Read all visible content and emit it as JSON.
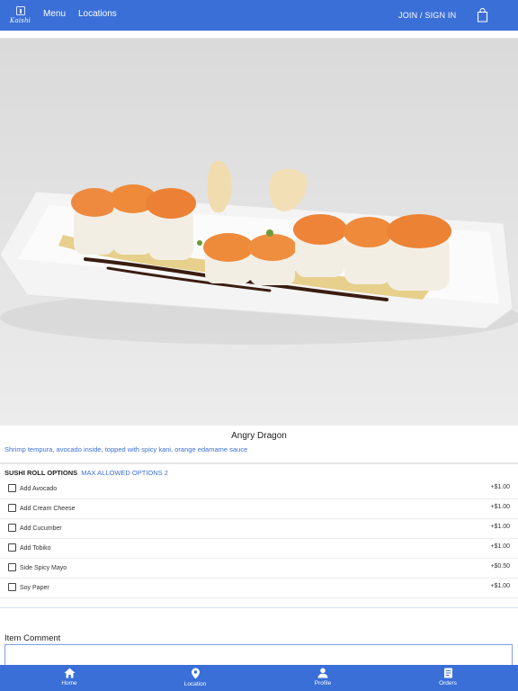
{
  "header": {
    "logo_text": "Kaishi",
    "nav": [
      {
        "label": "Menu"
      },
      {
        "label": "Locations"
      }
    ],
    "signin_label": "JOIN / SIGN IN",
    "cart_icon": "shopping-bag-icon"
  },
  "item": {
    "image_alt": "Angry Dragon sushi roll",
    "title": "Angry Dragon",
    "description": "Shrimp tempura, avocado inside, topped with spicy kani, orange edamame sauce"
  },
  "options": {
    "header_label": "SUSHI ROLL OPTIONS",
    "max_label": "MAX ALLOWED OPTIONS 2",
    "items": [
      {
        "name": "Add Avocado",
        "price": "+$1.00"
      },
      {
        "name": "Add Cream Cheese",
        "price": "+$1.00"
      },
      {
        "name": "Add Cucumber",
        "price": "+$1.00"
      },
      {
        "name": "Add Tobiko",
        "price": "+$1.00"
      },
      {
        "name": "Side Spicy Mayo",
        "price": "+$0.50"
      },
      {
        "name": "Soy Paper",
        "price": "+$1.00"
      }
    ]
  },
  "comment": {
    "label": "Item Comment",
    "value": ""
  },
  "bottom_nav": [
    {
      "label": "Home",
      "icon": "home-icon"
    },
    {
      "label": "Location",
      "icon": "location-pin-icon"
    },
    {
      "label": "Profile",
      "icon": "profile-icon"
    },
    {
      "label": "Orders",
      "icon": "orders-icon"
    }
  ],
  "colors": {
    "brand": "#3a6fd8",
    "link": "#3a6fd8"
  }
}
